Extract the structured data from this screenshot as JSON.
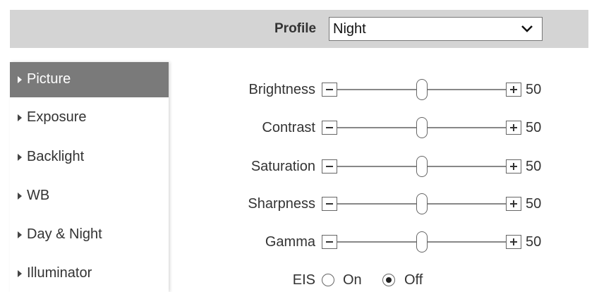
{
  "header": {
    "profile_label": "Profile",
    "profile_value": "Night"
  },
  "sidebar": {
    "items": [
      {
        "label": "Picture",
        "active": true
      },
      {
        "label": "Exposure",
        "active": false
      },
      {
        "label": "Backlight",
        "active": false
      },
      {
        "label": "WB",
        "active": false
      },
      {
        "label": "Day & Night",
        "active": false
      },
      {
        "label": "Illuminator",
        "active": false
      }
    ]
  },
  "sliders": [
    {
      "label": "Brightness",
      "value": "50",
      "level": 0.5
    },
    {
      "label": "Contrast",
      "value": "50",
      "level": 0.5
    },
    {
      "label": "Saturation",
      "value": "50",
      "level": 0.5
    },
    {
      "label": "Sharpness",
      "value": "50",
      "level": 0.5
    },
    {
      "label": "Gamma",
      "value": "50",
      "level": 0.5
    }
  ],
  "eis": {
    "label": "EIS",
    "options": [
      {
        "label": "On",
        "selected": false
      },
      {
        "label": "Off",
        "selected": true
      }
    ]
  },
  "colors": {
    "header_bar": "#d4d4d4",
    "active_nav": "#7a7a7a"
  }
}
